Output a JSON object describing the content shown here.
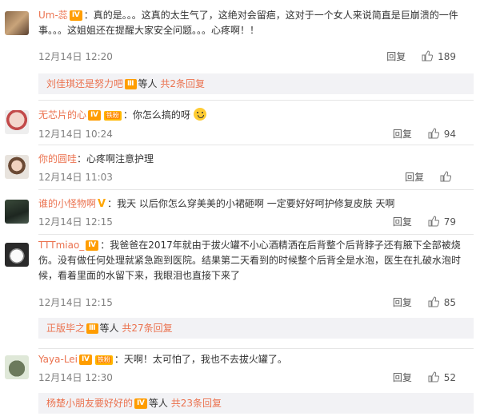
{
  "colors": {
    "username": "#eb7350",
    "badge": "#ff9d00",
    "subbar_bg": "#f2f2f5"
  },
  "comments": [
    {
      "user": "Um-蕊",
      "text": "：真的是。。。这真的太生气了，这绝对会留疤，这对于一个女人来说简直是巨崩溃的一件事。。。这姐姐还在提醒大家安全问题。。。心疼啊！！",
      "time": "12月14日 12:20",
      "reply": "回复",
      "likes": "189",
      "sub": {
        "user": "刘佳琪还是努力吧",
        "etc": "等人",
        "more": "共2条回复"
      }
    },
    {
      "user": "无芯片的心",
      "fan_label": "铁粉",
      "text": "：你怎么搞的呀",
      "time": "12月14日 10:24",
      "reply": "回复",
      "likes": "94"
    },
    {
      "user": "你的圆哇",
      "text": "：心疼啊注意护理",
      "time": "12月14日 11:03",
      "reply": "回复",
      "likes": ""
    },
    {
      "user": "谁的小怪物啊",
      "text": "：我天 以后你怎么穿美美的小裙砸啊 一定要好好呵护修复皮肤 天啊",
      "time": "12月14日 12:15",
      "reply": "回复",
      "likes": "79"
    },
    {
      "user": "TTTmiao_",
      "text": "：我爸爸在2017年就由于拔火罐不小心酒精洒在后背整个后背脖子还有腋下全部被烧伤。没有做任何处理就紧急跑到医院。结果第二天看到的时候整个后背全是水泡，医生在扎破水泡时候，看着里面的水留下来，我眼泪也直接下来了",
      "time": "12月14日 12:15",
      "reply": "回复",
      "likes": "85",
      "sub": {
        "user": "正版毕之",
        "etc": "等人",
        "more": "共27条回复"
      }
    },
    {
      "user": "Yaya-Lei",
      "fan_label": "铁粉",
      "text": "：天啊！太可怕了，我也不去拔火罐了。",
      "time": "12月14日 12:30",
      "reply": "回复",
      "likes": "52",
      "sub": {
        "user": "杨楚小朋友要好好的",
        "etc": "等人",
        "more": "共23条回复"
      }
    }
  ]
}
